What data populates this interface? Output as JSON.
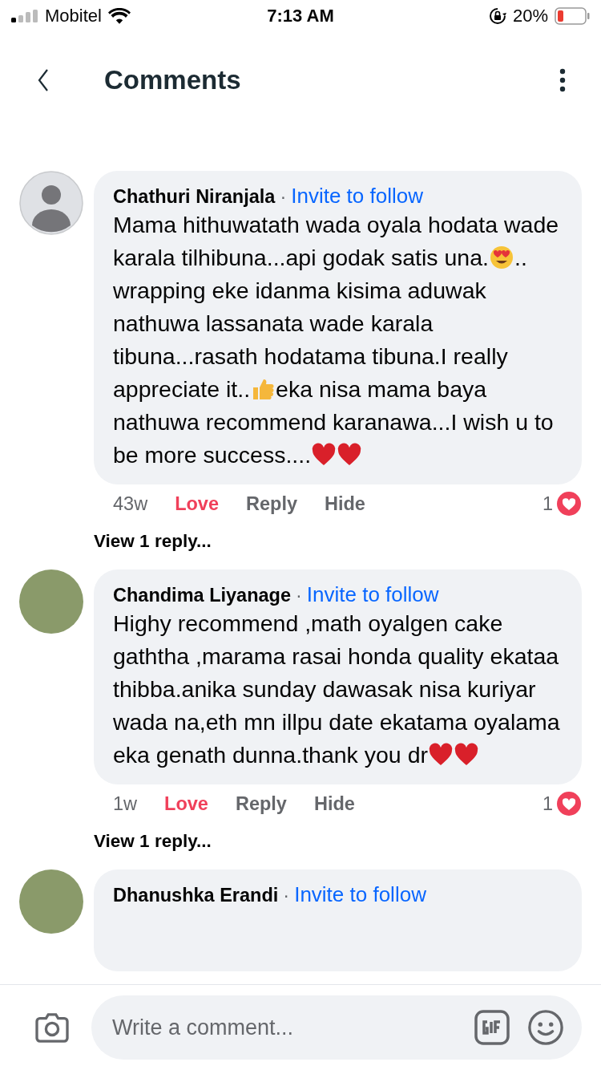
{
  "status_bar": {
    "carrier": "Mobitel",
    "time": "7:13 AM",
    "battery": "20%"
  },
  "header": {
    "title": "Comments"
  },
  "comments": [
    {
      "author": "Chathuri Niranjala",
      "separator": "·",
      "invite": "Invite to follow",
      "photo": false,
      "body": [
        {
          "kind": "text",
          "text": "Mama hithuwatath wada oyala hodata wade karala tilhibuna...api godak satis una."
        },
        {
          "kind": "heart-eyes"
        },
        {
          "kind": "text",
          "text": ".. wrapping eke idanma kisima aduwak nathuwa lassanata wade karala tibuna...rasath hodatama tibuna.I really appreciate it.."
        },
        {
          "kind": "thumbs-up"
        },
        {
          "kind": "text",
          "text": "eka nisa mama baya nathuwa recommend karanawa...I wish u to be more success...."
        },
        {
          "kind": "heart"
        },
        {
          "kind": "heart"
        }
      ],
      "time": "43w",
      "actions": [
        "Love",
        "Reply",
        "Hide"
      ],
      "loved": true,
      "reaction_count": "1",
      "more": "View 1 reply..."
    },
    {
      "author": "Chandima Liyanage",
      "separator": "·",
      "invite": "Invite to follow",
      "photo": true,
      "body": [
        {
          "kind": "text",
          "text": "Highy recommend ,math oyalgen cake gaththa ,marama rasai honda quality ekataa thibba.anika sunday dawasak nisa kuriyar wada na,eth mn illpu date ekatama oyalama eka genath dunna.thank you dr"
        },
        {
          "kind": "heart"
        },
        {
          "kind": "heart"
        }
      ],
      "time": "1w",
      "actions": [
        "Love",
        "Reply",
        "Hide"
      ],
      "loved": true,
      "reaction_count": "1",
      "more": "View 1 reply..."
    },
    {
      "author": "Dhanushka Erandi",
      "separator": "·",
      "invite": "Invite to follow",
      "photo": true
    }
  ],
  "composer": {
    "placeholder": "Write a comment..."
  }
}
